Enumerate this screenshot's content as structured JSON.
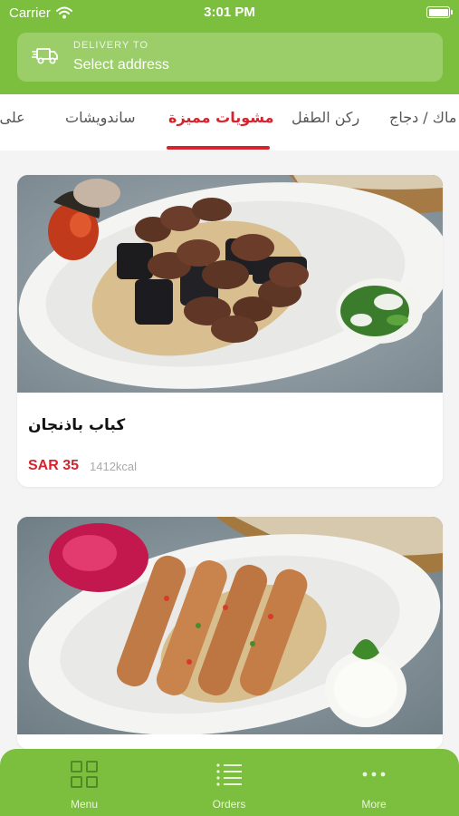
{
  "status_bar": {
    "carrier": "Carrier",
    "time": "3:01 PM",
    "icons": [
      "wifi-icon",
      "battery-icon"
    ]
  },
  "delivery": {
    "label": "DELIVERY TO",
    "value": "Select address",
    "icon": "truck-icon"
  },
  "category_tabs": {
    "items": [
      {
        "label": "على ا"
      },
      {
        "label": "ساندويشات"
      },
      {
        "label": "مشويات مميزة",
        "active": true
      },
      {
        "label": "ركن الطفل"
      },
      {
        "label": "ماك / دجاج"
      }
    ]
  },
  "products": [
    {
      "name": "كباب باذنجان",
      "price": "SAR 35",
      "calories": "1412kcal"
    },
    {
      "name": "",
      "price": "",
      "calories": ""
    }
  ],
  "bottom_nav": {
    "items": [
      {
        "label": "Menu",
        "icon": "grid-icon"
      },
      {
        "label": "Orders",
        "icon": "list-icon"
      },
      {
        "label": "More",
        "icon": "more-dots-icon"
      }
    ]
  },
  "colors": {
    "brand_green": "#7cbe3e",
    "accent_red": "#d6242e"
  }
}
